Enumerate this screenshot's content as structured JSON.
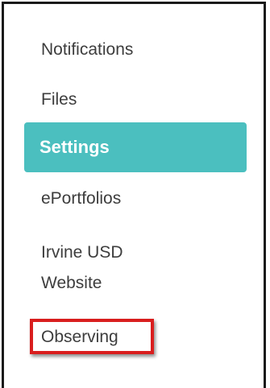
{
  "sidebar": {
    "items": [
      {
        "label": "Notifications",
        "active": false
      },
      {
        "label": "Files",
        "active": false
      },
      {
        "label": "Settings",
        "active": true
      },
      {
        "label": "ePortfolios",
        "active": false
      },
      {
        "label": "Irvine USD Website",
        "active": false
      },
      {
        "label": "Observing",
        "active": false,
        "highlighted": true
      }
    ]
  },
  "colors": {
    "active_background": "#4bbfbf",
    "active_text": "#ffffff",
    "item_text": "#3d3d3d",
    "highlight_border": "#d91e1e",
    "frame_border": "#1a1a1a"
  }
}
